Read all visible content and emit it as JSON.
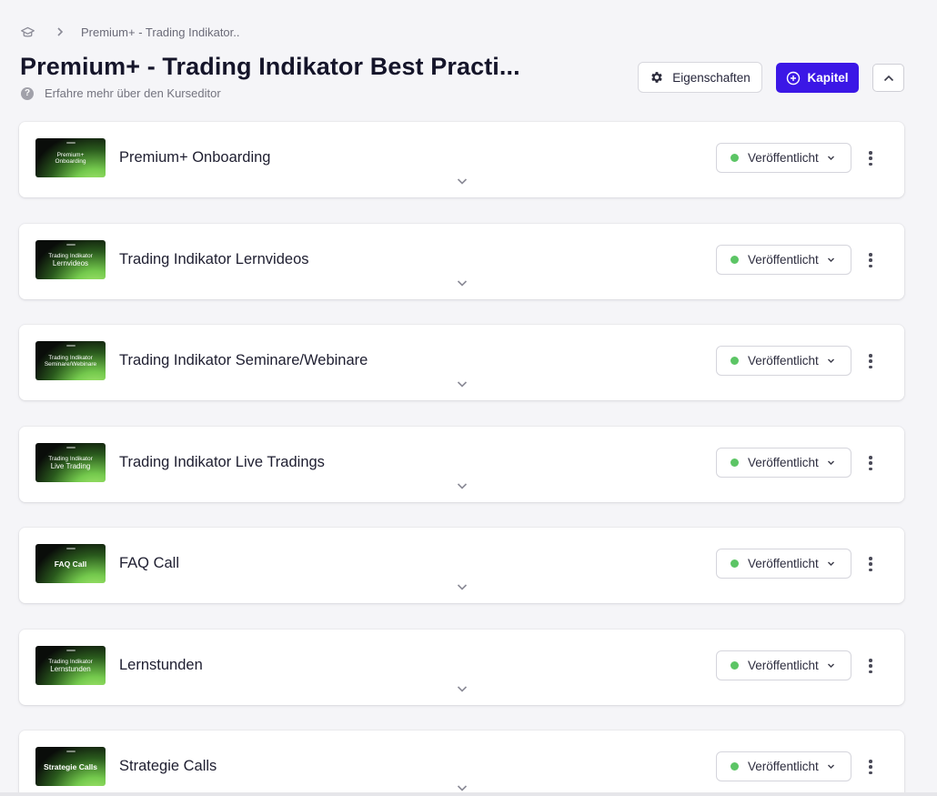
{
  "breadcrumb": {
    "items": [
      "Premium+ - Trading Indikator.."
    ]
  },
  "header": {
    "title": "Premium+ - Trading Indikator Best Practi...",
    "help_text": "Erfahre mehr über den Kurseditor",
    "properties_label": "Eigenschaften",
    "add_chapter_label": "Kapitel"
  },
  "colors": {
    "primary": "#3b17e6",
    "published_dot": "#5cc565"
  },
  "chapters": [
    {
      "title": "Premium+ Onboarding",
      "thumb_line1": "Premium+",
      "thumb_line2": "Onboarding",
      "status": "Veröffentlicht"
    },
    {
      "title": "Trading Indikator Lernvideos",
      "thumb_line1": "Trading Indikator",
      "thumb_line2": "Lernvideos",
      "status": "Veröffentlicht"
    },
    {
      "title": "Trading Indikator Seminare/Webinare",
      "thumb_line1": "Trading Indikator",
      "thumb_line2": "Seminare/Webinare",
      "status": "Veröffentlicht"
    },
    {
      "title": "Trading Indikator Live Tradings",
      "thumb_line1": "Trading Indikator",
      "thumb_line2": "Live Trading",
      "status": "Veröffentlicht"
    },
    {
      "title": "FAQ Call",
      "thumb_line1": "",
      "thumb_line2": "FAQ Call",
      "status": "Veröffentlicht"
    },
    {
      "title": "Lernstunden",
      "thumb_line1": "Trading Indikator",
      "thumb_line2": "Lernstunden",
      "status": "Veröffentlicht"
    },
    {
      "title": "Strategie Calls",
      "thumb_line1": "",
      "thumb_line2": "Strategie Calls",
      "status": "Veröffentlicht"
    }
  ]
}
